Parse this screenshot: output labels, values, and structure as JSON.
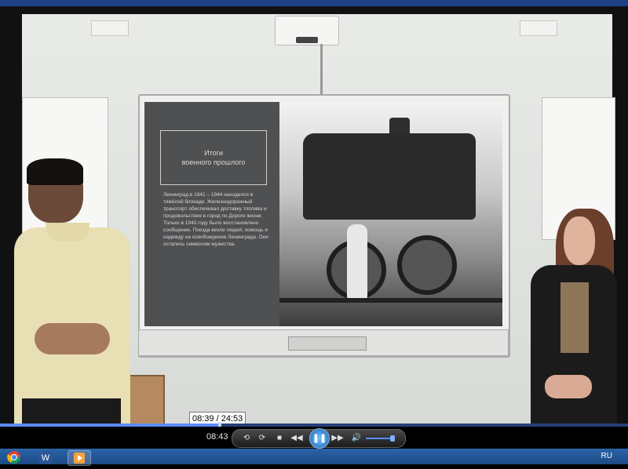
{
  "player": {
    "tooltip_time": "08:39 / 24:53",
    "elapsed": "08:43",
    "progress": 0.35,
    "volume": 0.85,
    "controls": {
      "mode_icon": "switch-view-icon",
      "refresh_icon": "repeat-icon",
      "stop_icon": "stop-icon",
      "rewind_icon": "rewind-icon",
      "pause_icon": "pause-icon",
      "forward_icon": "fast-forward-icon",
      "volume_icon": "speaker-icon"
    }
  },
  "slide": {
    "title_lines": [
      "Итоги",
      "военного прошлого"
    ],
    "body_text": "Ленинград в 1941 – 1944 находился в тяжёлой блокаде. Железнодорожный транспорт обеспечивал доставку топлива и продовольствия в город по Дороге жизни. Только в 1943 году было восстановлено сообщение. Поезда везли людей, помощь и надежду на освобождение Ленинграда. Они остались символом мужества."
  },
  "taskbar": {
    "apps": [
      {
        "name": "chrome-icon",
        "active": false
      },
      {
        "name": "word-icon",
        "active": false
      },
      {
        "name": "media-player-icon",
        "active": true
      }
    ],
    "language": "RU"
  },
  "colors": {
    "taskbar": "#1f4f92",
    "progress": "#5a8cff",
    "player_bg": "#000000"
  }
}
